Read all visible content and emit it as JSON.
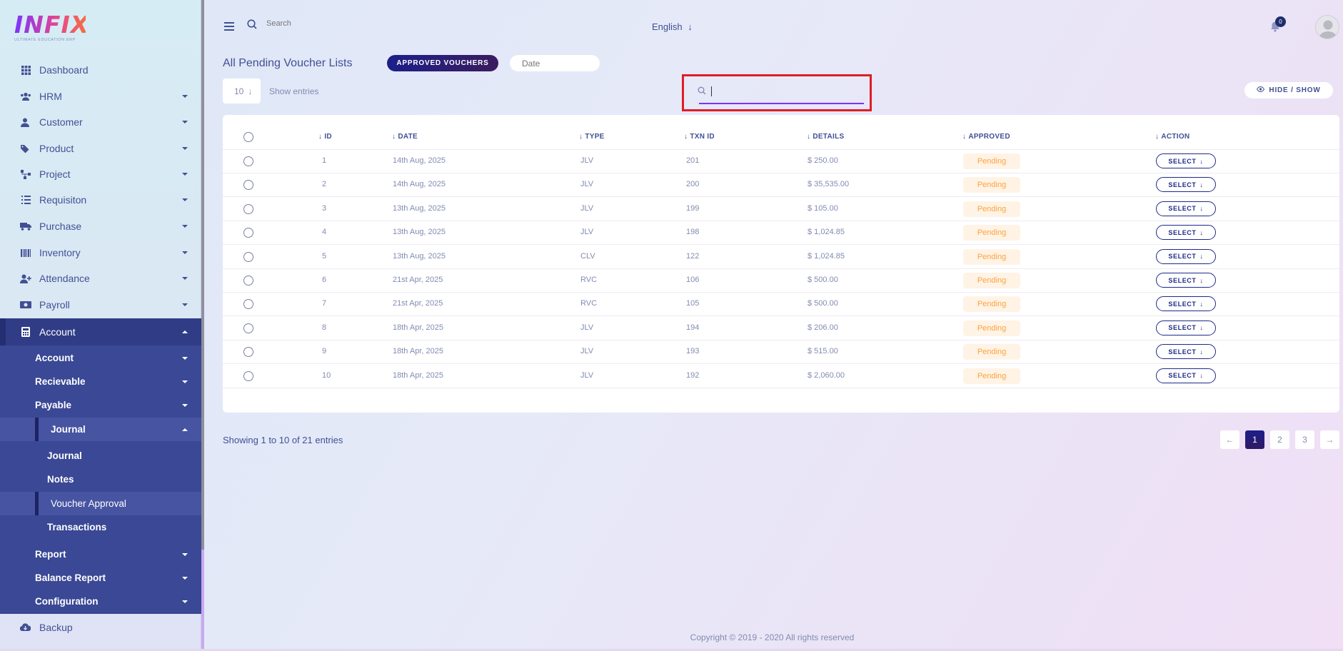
{
  "brand": {
    "name": "INFIX",
    "tagline": "ULTIMATE EDUCATION ERP"
  },
  "header": {
    "search_placeholder": "Search",
    "language": "English",
    "notifications_count": "0"
  },
  "sidebar": {
    "items": [
      {
        "label": "Dashboard",
        "icon": "grid-icon"
      },
      {
        "label": "HRM",
        "icon": "users-icon"
      },
      {
        "label": "Customer",
        "icon": "user-icon"
      },
      {
        "label": "Product",
        "icon": "tag-icon"
      },
      {
        "label": "Project",
        "icon": "project-icon"
      },
      {
        "label": "Requisiton",
        "icon": "list-icon"
      },
      {
        "label": "Purchase",
        "icon": "truck-icon"
      },
      {
        "label": "Inventory",
        "icon": "inventory-icon"
      },
      {
        "label": "Attendance",
        "icon": "user-plus-icon"
      },
      {
        "label": "Payroll",
        "icon": "money-icon"
      },
      {
        "label": "Account",
        "icon": "calculator-icon"
      }
    ],
    "account_submenu": {
      "account": "Account",
      "recievable": "Recievable",
      "payable": "Payable",
      "journal_group": "Journal",
      "journal": "Journal",
      "notes": "Notes",
      "voucher_approval": "Voucher Approval",
      "transactions": "Transactions",
      "report": "Report",
      "balance_report": "Balance Report",
      "configuration": "Configuration"
    },
    "backup": "Backup"
  },
  "toolbar": {
    "title": "All Pending Voucher Lists",
    "approved_button": "APPROVED VOUCHERS",
    "date_placeholder": "Date",
    "entries_value": "10",
    "entries_label": "Show entries",
    "hide_show": "HIDE / SHOW"
  },
  "table": {
    "columns": [
      "ID",
      "DATE",
      "TYPE",
      "TXN ID",
      "DETAILS",
      "APPROVED",
      "ACTION"
    ],
    "status_label": "Pending",
    "action_label": "SELECT",
    "rows": [
      {
        "id": "1",
        "date": "14th Aug, 2025",
        "type": "JLV",
        "txn": "201",
        "details": "$ 250.00"
      },
      {
        "id": "2",
        "date": "14th Aug, 2025",
        "type": "JLV",
        "txn": "200",
        "details": "$ 35,535.00"
      },
      {
        "id": "3",
        "date": "13th Aug, 2025",
        "type": "JLV",
        "txn": "199",
        "details": "$ 105.00"
      },
      {
        "id": "4",
        "date": "13th Aug, 2025",
        "type": "JLV",
        "txn": "198",
        "details": "$ 1,024.85"
      },
      {
        "id": "5",
        "date": "13th Aug, 2025",
        "type": "CLV",
        "txn": "122",
        "details": "$ 1,024.85"
      },
      {
        "id": "6",
        "date": "21st Apr, 2025",
        "type": "RVC",
        "txn": "106",
        "details": "$ 500.00"
      },
      {
        "id": "7",
        "date": "21st Apr, 2025",
        "type": "RVC",
        "txn": "105",
        "details": "$ 500.00"
      },
      {
        "id": "8",
        "date": "18th Apr, 2025",
        "type": "JLV",
        "txn": "194",
        "details": "$ 206.00"
      },
      {
        "id": "9",
        "date": "18th Apr, 2025",
        "type": "JLV",
        "txn": "193",
        "details": "$ 515.00"
      },
      {
        "id": "10",
        "date": "18th Apr, 2025",
        "type": "JLV",
        "txn": "192",
        "details": "$ 2,060.00"
      }
    ]
  },
  "pagination": {
    "summary": "Showing 1 to 10 of 21 entries",
    "pages": [
      "1",
      "2",
      "3"
    ],
    "current": "1"
  },
  "footer": {
    "copyright": "Copyright © 2019 - 2020 All rights reserved"
  },
  "colors": {
    "primary": "#415094",
    "accent": "#7c32ff",
    "sidebar_active": "#3a4895",
    "pending": "#fea23d",
    "highlight": "#e01d23"
  }
}
